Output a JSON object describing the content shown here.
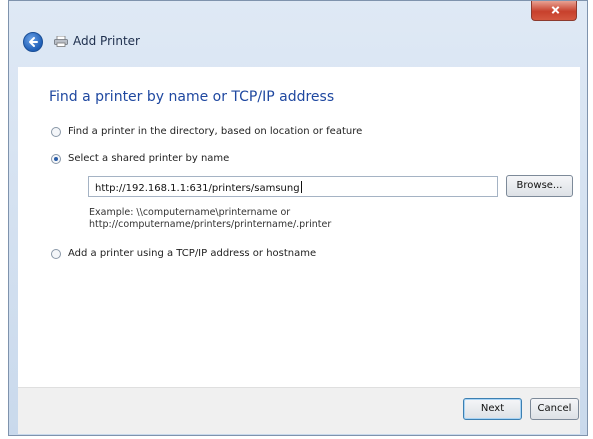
{
  "window": {
    "title": "Add Printer",
    "close_icon": "close-icon",
    "back_icon": "back-arrow-icon",
    "printer_icon": "printer-icon"
  },
  "main": {
    "heading": "Find a printer by name or TCP/IP address",
    "options": [
      {
        "label": "Find a printer in the directory, based on location or feature",
        "selected": false
      },
      {
        "label": "Select a shared printer by name",
        "selected": true
      },
      {
        "label": "Add a printer using a TCP/IP address or hostname",
        "selected": false
      }
    ],
    "printer_path_value": "http://192.168.1.1:631/printers/samsung",
    "browse_label": "Browse...",
    "example_line1": "Example: \\\\computername\\printername or",
    "example_line2": "http://computername/printers/printername/.printer"
  },
  "footer": {
    "next_label": "Next",
    "cancel_label": "Cancel"
  },
  "colors": {
    "heading": "#1f48a0",
    "window_chrome": "#c9d9ec",
    "close_button": "#c7402c"
  }
}
